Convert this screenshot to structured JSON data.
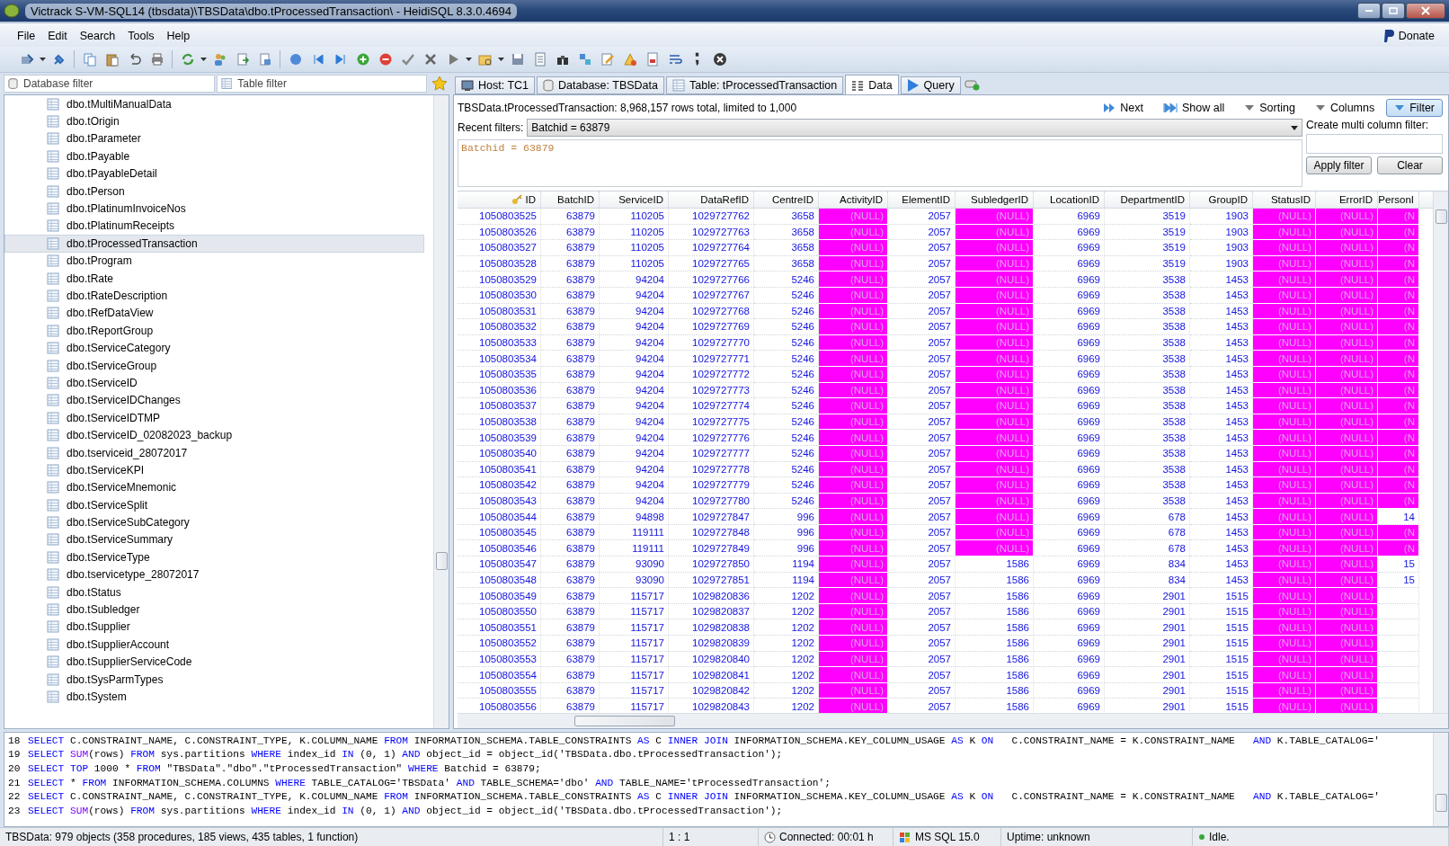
{
  "window": {
    "title": "Victrack S-VM-SQL14 (tbsdata)\\TBSData\\dbo.tProcessedTransaction\\ - HeidiSQL 8.3.0.4694"
  },
  "menu": [
    "File",
    "Edit",
    "Search",
    "Tools",
    "Help"
  ],
  "donate": "Donate",
  "filters": {
    "database_placeholder": "Database filter",
    "table_placeholder": "Table filter"
  },
  "tree": [
    {
      "label": "dbo.tMultiManualData",
      "selected": false
    },
    {
      "label": "dbo.tOrigin",
      "selected": false
    },
    {
      "label": "dbo.tParameter",
      "selected": false
    },
    {
      "label": "dbo.tPayable",
      "selected": false
    },
    {
      "label": "dbo.tPayableDetail",
      "selected": false
    },
    {
      "label": "dbo.tPerson",
      "selected": false
    },
    {
      "label": "dbo.tPlatinumInvoiceNos",
      "selected": false
    },
    {
      "label": "dbo.tPlatinumReceipts",
      "selected": false
    },
    {
      "label": "dbo.tProcessedTransaction",
      "selected": true
    },
    {
      "label": "dbo.tProgram",
      "selected": false
    },
    {
      "label": "dbo.tRate",
      "selected": false
    },
    {
      "label": "dbo.tRateDescription",
      "selected": false
    },
    {
      "label": "dbo.tRefDataView",
      "selected": false
    },
    {
      "label": "dbo.tReportGroup",
      "selected": false
    },
    {
      "label": "dbo.tServiceCategory",
      "selected": false
    },
    {
      "label": "dbo.tServiceGroup",
      "selected": false
    },
    {
      "label": "dbo.tServiceID",
      "selected": false
    },
    {
      "label": "dbo.tServiceIDChanges",
      "selected": false
    },
    {
      "label": "dbo.tServiceIDTMP",
      "selected": false
    },
    {
      "label": "dbo.tServiceID_02082023_backup",
      "selected": false
    },
    {
      "label": "dbo.tserviceid_28072017",
      "selected": false
    },
    {
      "label": "dbo.tServiceKPI",
      "selected": false
    },
    {
      "label": "dbo.tServiceMnemonic",
      "selected": false
    },
    {
      "label": "dbo.tServiceSplit",
      "selected": false
    },
    {
      "label": "dbo.tServiceSubCategory",
      "selected": false
    },
    {
      "label": "dbo.tServiceSummary",
      "selected": false
    },
    {
      "label": "dbo.tServiceType",
      "selected": false
    },
    {
      "label": "dbo.tservicetype_28072017",
      "selected": false
    },
    {
      "label": "dbo.tStatus",
      "selected": false
    },
    {
      "label": "dbo.tSubledger",
      "selected": false
    },
    {
      "label": "dbo.tSupplier",
      "selected": false
    },
    {
      "label": "dbo.tSupplierAccount",
      "selected": false
    },
    {
      "label": "dbo.tSupplierServiceCode",
      "selected": false
    },
    {
      "label": "dbo.tSysParmTypes",
      "selected": false
    },
    {
      "label": "dbo.tSystem",
      "selected": false
    }
  ],
  "tabs": [
    {
      "label": "Host: TC1",
      "selected": false
    },
    {
      "label": "Database: TBSData",
      "selected": false
    },
    {
      "label": "Table: tProcessedTransaction",
      "selected": false
    },
    {
      "label": "Data",
      "selected": true
    },
    {
      "label": "Query",
      "selected": false
    }
  ],
  "data_info": "TBSData.tProcessedTransaction: 8,968,157 rows total, limited to 1,000",
  "data_buttons": [
    {
      "label": "Next",
      "pressed": false
    },
    {
      "label": "Show all",
      "pressed": false
    },
    {
      "label": "Sorting",
      "pressed": false
    },
    {
      "label": "Columns",
      "pressed": false
    },
    {
      "label": "Filter",
      "pressed": true
    }
  ],
  "filter_panel": {
    "recent_label": "Recent filters:",
    "recent_value": "Batchid = 63879",
    "editor_text": "Batchid = 63879",
    "multi_label": "Create multi column filter:",
    "apply": "Apply filter",
    "clear": "Clear"
  },
  "table": {
    "columns": [
      "ID",
      "BatchID",
      "ServiceID",
      "DataRefID",
      "CentreID",
      "ActivityID",
      "ElementID",
      "SubledgerID",
      "LocationID",
      "DepartmentID",
      "GroupID",
      "StatusID",
      "ErrorID",
      "PersonI"
    ],
    "rows": [
      {
        "cells": [
          "1050803525",
          "63879",
          "110205",
          "1029727762",
          "3658",
          "(NULL)",
          "2057",
          "(NULL)",
          "6969",
          "3519",
          "1903",
          "(NULL)",
          "(NULL)",
          "(N"
        ],
        "is_null": [
          false,
          false,
          false,
          false,
          false,
          true,
          false,
          true,
          false,
          false,
          false,
          true,
          true,
          true
        ]
      },
      {
        "cells": [
          "1050803526",
          "63879",
          "110205",
          "1029727763",
          "3658",
          "(NULL)",
          "2057",
          "(NULL)",
          "6969",
          "3519",
          "1903",
          "(NULL)",
          "(NULL)",
          "(N"
        ],
        "is_null": [
          false,
          false,
          false,
          false,
          false,
          true,
          false,
          true,
          false,
          false,
          false,
          true,
          true,
          true
        ]
      },
      {
        "cells": [
          "1050803527",
          "63879",
          "110205",
          "1029727764",
          "3658",
          "(NULL)",
          "2057",
          "(NULL)",
          "6969",
          "3519",
          "1903",
          "(NULL)",
          "(NULL)",
          "(N"
        ],
        "is_null": [
          false,
          false,
          false,
          false,
          false,
          true,
          false,
          true,
          false,
          false,
          false,
          true,
          true,
          true
        ]
      },
      {
        "cells": [
          "1050803528",
          "63879",
          "110205",
          "1029727765",
          "3658",
          "(NULL)",
          "2057",
          "(NULL)",
          "6969",
          "3519",
          "1903",
          "(NULL)",
          "(NULL)",
          "(N"
        ],
        "is_null": [
          false,
          false,
          false,
          false,
          false,
          true,
          false,
          true,
          false,
          false,
          false,
          true,
          true,
          true
        ]
      },
      {
        "cells": [
          "1050803529",
          "63879",
          "94204",
          "1029727766",
          "5246",
          "(NULL)",
          "2057",
          "(NULL)",
          "6969",
          "3538",
          "1453",
          "(NULL)",
          "(NULL)",
          "(N"
        ],
        "is_null": [
          false,
          false,
          false,
          false,
          false,
          true,
          false,
          true,
          false,
          false,
          false,
          true,
          true,
          true
        ]
      },
      {
        "cells": [
          "1050803530",
          "63879",
          "94204",
          "1029727767",
          "5246",
          "(NULL)",
          "2057",
          "(NULL)",
          "6969",
          "3538",
          "1453",
          "(NULL)",
          "(NULL)",
          "(N"
        ],
        "is_null": [
          false,
          false,
          false,
          false,
          false,
          true,
          false,
          true,
          false,
          false,
          false,
          true,
          true,
          true
        ]
      },
      {
        "cells": [
          "1050803531",
          "63879",
          "94204",
          "1029727768",
          "5246",
          "(NULL)",
          "2057",
          "(NULL)",
          "6969",
          "3538",
          "1453",
          "(NULL)",
          "(NULL)",
          "(N"
        ],
        "is_null": [
          false,
          false,
          false,
          false,
          false,
          true,
          false,
          true,
          false,
          false,
          false,
          true,
          true,
          true
        ]
      },
      {
        "cells": [
          "1050803532",
          "63879",
          "94204",
          "1029727769",
          "5246",
          "(NULL)",
          "2057",
          "(NULL)",
          "6969",
          "3538",
          "1453",
          "(NULL)",
          "(NULL)",
          "(N"
        ],
        "is_null": [
          false,
          false,
          false,
          false,
          false,
          true,
          false,
          true,
          false,
          false,
          false,
          true,
          true,
          true
        ]
      },
      {
        "cells": [
          "1050803533",
          "63879",
          "94204",
          "1029727770",
          "5246",
          "(NULL)",
          "2057",
          "(NULL)",
          "6969",
          "3538",
          "1453",
          "(NULL)",
          "(NULL)",
          "(N"
        ],
        "is_null": [
          false,
          false,
          false,
          false,
          false,
          true,
          false,
          true,
          false,
          false,
          false,
          true,
          true,
          true
        ]
      },
      {
        "cells": [
          "1050803534",
          "63879",
          "94204",
          "1029727771",
          "5246",
          "(NULL)",
          "2057",
          "(NULL)",
          "6969",
          "3538",
          "1453",
          "(NULL)",
          "(NULL)",
          "(N"
        ],
        "is_null": [
          false,
          false,
          false,
          false,
          false,
          true,
          false,
          true,
          false,
          false,
          false,
          true,
          true,
          true
        ]
      },
      {
        "cells": [
          "1050803535",
          "63879",
          "94204",
          "1029727772",
          "5246",
          "(NULL)",
          "2057",
          "(NULL)",
          "6969",
          "3538",
          "1453",
          "(NULL)",
          "(NULL)",
          "(N"
        ],
        "is_null": [
          false,
          false,
          false,
          false,
          false,
          true,
          false,
          true,
          false,
          false,
          false,
          true,
          true,
          true
        ]
      },
      {
        "cells": [
          "1050803536",
          "63879",
          "94204",
          "1029727773",
          "5246",
          "(NULL)",
          "2057",
          "(NULL)",
          "6969",
          "3538",
          "1453",
          "(NULL)",
          "(NULL)",
          "(N"
        ],
        "is_null": [
          false,
          false,
          false,
          false,
          false,
          true,
          false,
          true,
          false,
          false,
          false,
          true,
          true,
          true
        ]
      },
      {
        "cells": [
          "1050803537",
          "63879",
          "94204",
          "1029727774",
          "5246",
          "(NULL)",
          "2057",
          "(NULL)",
          "6969",
          "3538",
          "1453",
          "(NULL)",
          "(NULL)",
          "(N"
        ],
        "is_null": [
          false,
          false,
          false,
          false,
          false,
          true,
          false,
          true,
          false,
          false,
          false,
          true,
          true,
          true
        ]
      },
      {
        "cells": [
          "1050803538",
          "63879",
          "94204",
          "1029727775",
          "5246",
          "(NULL)",
          "2057",
          "(NULL)",
          "6969",
          "3538",
          "1453",
          "(NULL)",
          "(NULL)",
          "(N"
        ],
        "is_null": [
          false,
          false,
          false,
          false,
          false,
          true,
          false,
          true,
          false,
          false,
          false,
          true,
          true,
          true
        ]
      },
      {
        "cells": [
          "1050803539",
          "63879",
          "94204",
          "1029727776",
          "5246",
          "(NULL)",
          "2057",
          "(NULL)",
          "6969",
          "3538",
          "1453",
          "(NULL)",
          "(NULL)",
          "(N"
        ],
        "is_null": [
          false,
          false,
          false,
          false,
          false,
          true,
          false,
          true,
          false,
          false,
          false,
          true,
          true,
          true
        ]
      },
      {
        "cells": [
          "1050803540",
          "63879",
          "94204",
          "1029727777",
          "5246",
          "(NULL)",
          "2057",
          "(NULL)",
          "6969",
          "3538",
          "1453",
          "(NULL)",
          "(NULL)",
          "(N"
        ],
        "is_null": [
          false,
          false,
          false,
          false,
          false,
          true,
          false,
          true,
          false,
          false,
          false,
          true,
          true,
          true
        ]
      },
      {
        "cells": [
          "1050803541",
          "63879",
          "94204",
          "1029727778",
          "5246",
          "(NULL)",
          "2057",
          "(NULL)",
          "6969",
          "3538",
          "1453",
          "(NULL)",
          "(NULL)",
          "(N"
        ],
        "is_null": [
          false,
          false,
          false,
          false,
          false,
          true,
          false,
          true,
          false,
          false,
          false,
          true,
          true,
          true
        ]
      },
      {
        "cells": [
          "1050803542",
          "63879",
          "94204",
          "1029727779",
          "5246",
          "(NULL)",
          "2057",
          "(NULL)",
          "6969",
          "3538",
          "1453",
          "(NULL)",
          "(NULL)",
          "(N"
        ],
        "is_null": [
          false,
          false,
          false,
          false,
          false,
          true,
          false,
          true,
          false,
          false,
          false,
          true,
          true,
          true
        ]
      },
      {
        "cells": [
          "1050803543",
          "63879",
          "94204",
          "1029727780",
          "5246",
          "(NULL)",
          "2057",
          "(NULL)",
          "6969",
          "3538",
          "1453",
          "(NULL)",
          "(NULL)",
          "(N"
        ],
        "is_null": [
          false,
          false,
          false,
          false,
          false,
          true,
          false,
          true,
          false,
          false,
          false,
          true,
          true,
          true
        ]
      },
      {
        "cells": [
          "1050803544",
          "63879",
          "94898",
          "1029727847",
          "996",
          "(NULL)",
          "2057",
          "(NULL)",
          "6969",
          "678",
          "1453",
          "(NULL)",
          "(NULL)",
          "14"
        ],
        "is_null": [
          false,
          false,
          false,
          false,
          false,
          true,
          false,
          true,
          false,
          false,
          false,
          true,
          true,
          false
        ]
      },
      {
        "cells": [
          "1050803545",
          "63879",
          "119111",
          "1029727848",
          "996",
          "(NULL)",
          "2057",
          "(NULL)",
          "6969",
          "678",
          "1453",
          "(NULL)",
          "(NULL)",
          "(N"
        ],
        "is_null": [
          false,
          false,
          false,
          false,
          false,
          true,
          false,
          true,
          false,
          false,
          false,
          true,
          true,
          true
        ]
      },
      {
        "cells": [
          "1050803546",
          "63879",
          "119111",
          "1029727849",
          "996",
          "(NULL)",
          "2057",
          "(NULL)",
          "6969",
          "678",
          "1453",
          "(NULL)",
          "(NULL)",
          "(N"
        ],
        "is_null": [
          false,
          false,
          false,
          false,
          false,
          true,
          false,
          true,
          false,
          false,
          false,
          true,
          true,
          true
        ]
      },
      {
        "cells": [
          "1050803547",
          "63879",
          "93090",
          "1029727850",
          "1194",
          "(NULL)",
          "2057",
          "1586",
          "6969",
          "834",
          "1453",
          "(NULL)",
          "(NULL)",
          "15"
        ],
        "is_null": [
          false,
          false,
          false,
          false,
          false,
          true,
          false,
          false,
          false,
          false,
          false,
          true,
          true,
          false
        ]
      },
      {
        "cells": [
          "1050803548",
          "63879",
          "93090",
          "1029727851",
          "1194",
          "(NULL)",
          "2057",
          "1586",
          "6969",
          "834",
          "1453",
          "(NULL)",
          "(NULL)",
          "15"
        ],
        "is_null": [
          false,
          false,
          false,
          false,
          false,
          true,
          false,
          false,
          false,
          false,
          false,
          true,
          true,
          false
        ]
      },
      {
        "cells": [
          "1050803549",
          "63879",
          "115717",
          "1029820836",
          "1202",
          "(NULL)",
          "2057",
          "1586",
          "6969",
          "2901",
          "1515",
          "(NULL)",
          "(NULL)"
        ],
        "is_null": [
          false,
          false,
          false,
          false,
          false,
          true,
          false,
          false,
          false,
          false,
          false,
          true,
          true
        ]
      },
      {
        "cells": [
          "1050803550",
          "63879",
          "115717",
          "1029820837",
          "1202",
          "(NULL)",
          "2057",
          "1586",
          "6969",
          "2901",
          "1515",
          "(NULL)",
          "(NULL)"
        ],
        "is_null": [
          false,
          false,
          false,
          false,
          false,
          true,
          false,
          false,
          false,
          false,
          false,
          true,
          true
        ]
      },
      {
        "cells": [
          "1050803551",
          "63879",
          "115717",
          "1029820838",
          "1202",
          "(NULL)",
          "2057",
          "1586",
          "6969",
          "2901",
          "1515",
          "(NULL)",
          "(NULL)"
        ],
        "is_null": [
          false,
          false,
          false,
          false,
          false,
          true,
          false,
          false,
          false,
          false,
          false,
          true,
          true
        ]
      },
      {
        "cells": [
          "1050803552",
          "63879",
          "115717",
          "1029820839",
          "1202",
          "(NULL)",
          "2057",
          "1586",
          "6969",
          "2901",
          "1515",
          "(NULL)",
          "(NULL)"
        ],
        "is_null": [
          false,
          false,
          false,
          false,
          false,
          true,
          false,
          false,
          false,
          false,
          false,
          true,
          true
        ]
      },
      {
        "cells": [
          "1050803553",
          "63879",
          "115717",
          "1029820840",
          "1202",
          "(NULL)",
          "2057",
          "1586",
          "6969",
          "2901",
          "1515",
          "(NULL)",
          "(NULL)"
        ],
        "is_null": [
          false,
          false,
          false,
          false,
          false,
          true,
          false,
          false,
          false,
          false,
          false,
          true,
          true
        ]
      },
      {
        "cells": [
          "1050803554",
          "63879",
          "115717",
          "1029820841",
          "1202",
          "(NULL)",
          "2057",
          "1586",
          "6969",
          "2901",
          "1515",
          "(NULL)",
          "(NULL)"
        ],
        "is_null": [
          false,
          false,
          false,
          false,
          false,
          true,
          false,
          false,
          false,
          false,
          false,
          true,
          true
        ]
      },
      {
        "cells": [
          "1050803555",
          "63879",
          "115717",
          "1029820842",
          "1202",
          "(NULL)",
          "2057",
          "1586",
          "6969",
          "2901",
          "1515",
          "(NULL)",
          "(NULL)"
        ],
        "is_null": [
          false,
          false,
          false,
          false,
          false,
          true,
          false,
          false,
          false,
          false,
          false,
          true,
          true
        ]
      },
      {
        "cells": [
          "1050803556",
          "63879",
          "115717",
          "1029820843",
          "1202",
          "(NULL)",
          "2057",
          "1586",
          "6969",
          "2901",
          "1515",
          "(NULL)",
          "(NULL)"
        ],
        "is_null": [
          false,
          false,
          false,
          false,
          false,
          true,
          false,
          false,
          false,
          false,
          false,
          true,
          true
        ]
      }
    ]
  },
  "log": [
    {
      "number": "18",
      "parts": [
        {
          "kind": "kw",
          "text": "SELECT"
        },
        {
          "kind": "txt",
          "text": " C.CONSTRAINT_NAME, C.CONSTRAINT_TYPE, K.COLUMN_NAME "
        },
        {
          "kind": "kw",
          "text": "FROM"
        },
        {
          "kind": "txt",
          "text": " INFORMATION_SCHEMA.TABLE_CONSTRAINTS "
        },
        {
          "kind": "kw",
          "text": "AS"
        },
        {
          "kind": "txt",
          "text": " C "
        },
        {
          "kind": "kw",
          "text": "INNER JOIN"
        },
        {
          "kind": "txt",
          "text": " INFORMATION_SCHEMA.KEY_COLUMN_USAGE "
        },
        {
          "kind": "kw",
          "text": "AS"
        },
        {
          "kind": "txt",
          "text": " K "
        },
        {
          "kind": "kw",
          "text": "ON"
        },
        {
          "kind": "txt",
          "text": "   C.CONSTRAINT_NAME = K.CONSTRAINT_NAME   "
        },
        {
          "kind": "kw",
          "text": "AND"
        },
        {
          "kind": "txt",
          "text": " K.TABLE_CATALOG='"
        }
      ]
    },
    {
      "number": "19",
      "parts": [
        {
          "kind": "kw",
          "text": "SELECT"
        },
        {
          "kind": "fn",
          "text": " SUM"
        },
        {
          "kind": "txt",
          "text": "(rows) "
        },
        {
          "kind": "kw",
          "text": "FROM"
        },
        {
          "kind": "txt",
          "text": " sys.partitions "
        },
        {
          "kind": "kw",
          "text": "WHERE"
        },
        {
          "kind": "txt",
          "text": " index_id "
        },
        {
          "kind": "kw",
          "text": "IN"
        },
        {
          "kind": "txt",
          "text": " (0, 1) "
        },
        {
          "kind": "kw",
          "text": "AND"
        },
        {
          "kind": "txt",
          "text": " object_id = object_id('TBSData.dbo.tProcessedTransaction');"
        }
      ]
    },
    {
      "number": "20",
      "parts": [
        {
          "kind": "kw",
          "text": "SELECT TOP"
        },
        {
          "kind": "txt",
          "text": " 1000 * "
        },
        {
          "kind": "kw",
          "text": "FROM"
        },
        {
          "kind": "txt",
          "text": " \"TBSData\".\"dbo\".\"tProcessedTransaction\" "
        },
        {
          "kind": "kw",
          "text": "WHERE"
        },
        {
          "kind": "txt",
          "text": " Batchid = 63879;"
        }
      ]
    },
    {
      "number": "21",
      "parts": [
        {
          "kind": "kw",
          "text": "SELECT"
        },
        {
          "kind": "txt",
          "text": " * "
        },
        {
          "kind": "kw",
          "text": "FROM"
        },
        {
          "kind": "txt",
          "text": " INFORMATION_SCHEMA.COLUMNS "
        },
        {
          "kind": "kw",
          "text": "WHERE"
        },
        {
          "kind": "txt",
          "text": " TABLE_CATALOG='TBSData' "
        },
        {
          "kind": "kw",
          "text": "AND"
        },
        {
          "kind": "txt",
          "text": " TABLE_SCHEMA='dbo' "
        },
        {
          "kind": "kw",
          "text": "AND"
        },
        {
          "kind": "txt",
          "text": " TABLE_NAME='tProcessedTransaction';"
        }
      ]
    },
    {
      "number": "22",
      "parts": [
        {
          "kind": "kw",
          "text": "SELECT"
        },
        {
          "kind": "txt",
          "text": " C.CONSTRAINT_NAME, C.CONSTRAINT_TYPE, K.COLUMN_NAME "
        },
        {
          "kind": "kw",
          "text": "FROM"
        },
        {
          "kind": "txt",
          "text": " INFORMATION_SCHEMA.TABLE_CONSTRAINTS "
        },
        {
          "kind": "kw",
          "text": "AS"
        },
        {
          "kind": "txt",
          "text": " C "
        },
        {
          "kind": "kw",
          "text": "INNER JOIN"
        },
        {
          "kind": "txt",
          "text": " INFORMATION_SCHEMA.KEY_COLUMN_USAGE "
        },
        {
          "kind": "kw",
          "text": "AS"
        },
        {
          "kind": "txt",
          "text": " K "
        },
        {
          "kind": "kw",
          "text": "ON"
        },
        {
          "kind": "txt",
          "text": "   C.CONSTRAINT_NAME = K.CONSTRAINT_NAME   "
        },
        {
          "kind": "kw",
          "text": "AND"
        },
        {
          "kind": "txt",
          "text": " K.TABLE_CATALOG='"
        }
      ]
    },
    {
      "number": "23",
      "parts": [
        {
          "kind": "kw",
          "text": "SELECT"
        },
        {
          "kind": "fn",
          "text": " SUM"
        },
        {
          "kind": "txt",
          "text": "(rows) "
        },
        {
          "kind": "kw",
          "text": "FROM"
        },
        {
          "kind": "txt",
          "text": " sys.partitions "
        },
        {
          "kind": "kw",
          "text": "WHERE"
        },
        {
          "kind": "txt",
          "text": " index_id "
        },
        {
          "kind": "kw",
          "text": "IN"
        },
        {
          "kind": "txt",
          "text": " (0, 1) "
        },
        {
          "kind": "kw",
          "text": "AND"
        },
        {
          "kind": "txt",
          "text": " object_id = object_id('TBSData.dbo.tProcessedTransaction');"
        }
      ]
    }
  ],
  "status_bar": {
    "objects": "TBSData: 979 objects (358 procedures, 185 views, 435 tables, 1 function)",
    "position": "1 : 1",
    "connected": "Connected: 00:01 h",
    "server": "MS SQL 15.0",
    "uptime": "Uptime: unknown",
    "state": "Idle."
  }
}
